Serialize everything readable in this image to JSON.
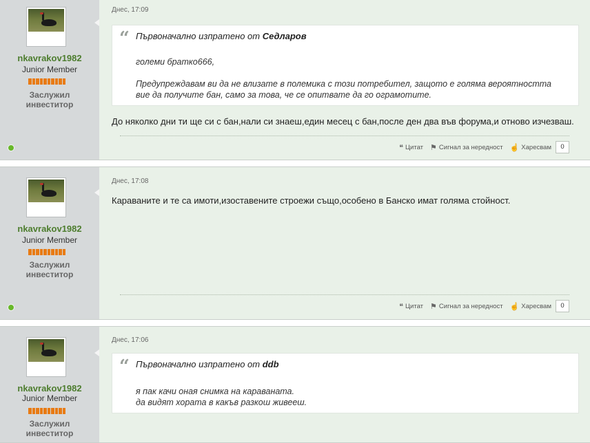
{
  "posts": [
    {
      "username": "nkavrakov1982",
      "user_title": "Junior Member",
      "rank": [
        "Заслужил",
        "инвеститор"
      ],
      "date": "Днес, 17:09",
      "quote": {
        "prefix": "Първоначално изпратено от",
        "author": "Седларов",
        "lines": [
          "големи братко666,",
          "",
          "Предупреждавам ви да не влизате в полемика с този потребител, защото е голяма вероятността",
          "вие да получите бан, само за това, че се опитвате да го ограмотите."
        ]
      },
      "message": "До няколко дни ти ще си с бан,нали си знаеш,един месец с бан,после ден два във форума,и отново изчезваш.",
      "actions": {
        "quote": "Цитат",
        "report": "Сигнал за нередност",
        "like": "Харесвам",
        "likes": "0"
      }
    },
    {
      "username": "nkavrakov1982",
      "user_title": "Junior Member",
      "rank": [
        "Заслужил",
        "инвеститор"
      ],
      "date": "Днес, 17:08",
      "message": "Караваните и те са имоти,изоставените строежи също,особено в Банско имат голяма стойност.",
      "actions": {
        "quote": "Цитат",
        "report": "Сигнал за нередност",
        "like": "Харесвам",
        "likes": "0"
      }
    },
    {
      "username": "nkavrakov1982",
      "user_title": "Junior Member",
      "rank": [
        "Заслужил",
        "инвеститор"
      ],
      "date": "Днес, 17:06",
      "quote": {
        "prefix": "Първоначално изпратено от",
        "author": "ddb",
        "lines": [
          "я пак качи оная снимка на караваната.",
          "да видят хората в какъв разкош живееш."
        ]
      }
    }
  ],
  "icons": {
    "quote": "quote-icon",
    "report": "flag-icon",
    "like": "thumbs-up-icon",
    "online": "online-status-icon"
  },
  "colors": {
    "username": "#4d7d2e",
    "rep_bar": "#e87b14",
    "online": "#68b82a",
    "post_bg": "#e9f1e8",
    "sidebar_bg": "#d6d9da"
  }
}
